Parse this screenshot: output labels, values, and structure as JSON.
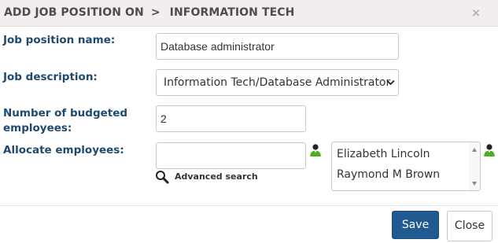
{
  "header": {
    "title_prefix": "ADD JOB POSITION ON",
    "separator": ">",
    "title_context": "INFORMATION TECH",
    "close_glyph": "×"
  },
  "form": {
    "job_position_name": {
      "label": "Job position name:",
      "value": "Database administrator"
    },
    "job_description": {
      "label": "Job description:",
      "selected": "Information Tech/Database Administrator"
    },
    "budgeted_employees": {
      "label_line1": "Number of budgeted",
      "label_line2": "employees:",
      "value": "2"
    },
    "allocate_employees": {
      "label": "Allocate employees:",
      "search_value": "",
      "advanced_search_label": "Advanced search",
      "allocated": [
        "Elizabeth Lincoln",
        "Raymond M Brown"
      ]
    }
  },
  "footer": {
    "save_label": "Save",
    "close_label": "Close"
  },
  "icons": {
    "close": "close-icon",
    "dropdown": "chevron-down-icon",
    "add_person": "add-person-icon",
    "search": "search-icon"
  },
  "colors": {
    "header_bg": "#f2eeee",
    "label": "#1f4a6e",
    "primary_button": "#215a91",
    "person_icon_green": "#4caf1e"
  }
}
